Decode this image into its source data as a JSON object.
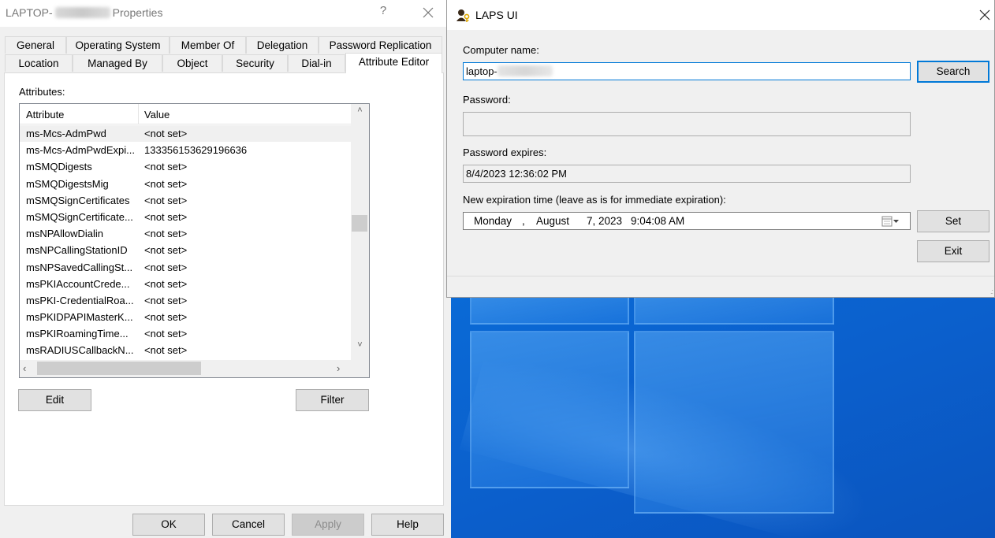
{
  "properties_dialog": {
    "title_prefix": "LAPTOP-",
    "title_suffix": "Properties",
    "help_button": "?",
    "tabs_row1": [
      "General",
      "Operating System",
      "Member Of",
      "Delegation",
      "Password Replication"
    ],
    "tabs_row2": [
      "Location",
      "Managed By",
      "Object",
      "Security",
      "Dial-in",
      "Attribute Editor"
    ],
    "active_tab": "Attribute Editor",
    "attributes_label": "Attributes:",
    "columns": [
      "Attribute",
      "Value"
    ],
    "rows": [
      [
        "ms-Mcs-AdmPwd",
        "<not set>"
      ],
      [
        "ms-Mcs-AdmPwdExpi...",
        "133356153629196636"
      ],
      [
        "mSMQDigests",
        "<not set>"
      ],
      [
        "mSMQDigestsMig",
        "<not set>"
      ],
      [
        "mSMQSignCertificates",
        "<not set>"
      ],
      [
        "mSMQSignCertificate...",
        "<not set>"
      ],
      [
        "msNPAllowDialin",
        "<not set>"
      ],
      [
        "msNPCallingStationID",
        "<not set>"
      ],
      [
        "msNPSavedCallingSt...",
        "<not set>"
      ],
      [
        "msPKIAccountCrede...",
        "<not set>"
      ],
      [
        "msPKI-CredentialRoa...",
        "<not set>"
      ],
      [
        "msPKIDPAPIMasterK...",
        "<not set>"
      ],
      [
        "msPKIRoamingTime...",
        "<not set>"
      ],
      [
        "msRADIUSCallbackN...",
        "<not set>"
      ]
    ],
    "edit_button": "Edit",
    "filter_button": "Filter",
    "ok_button": "OK",
    "cancel_button": "Cancel",
    "apply_button": "Apply",
    "help_text_button": "Help"
  },
  "laps_window": {
    "title": "LAPS UI",
    "computer_name_label": "Computer name:",
    "computer_name_value": "laptop-",
    "search_button": "Search",
    "password_label": "Password:",
    "password_value": "",
    "password_expires_label": "Password expires:",
    "password_expires_value": "8/4/2023 12:36:02 PM",
    "new_expiration_label": "New expiration time (leave as is for immediate expiration):",
    "new_expiration": {
      "weekday": "Monday",
      "sep": ",",
      "month": "August",
      "day_year": "7, 2023",
      "time": "9:04:08 AM"
    },
    "set_button": "Set",
    "exit_button": "Exit"
  }
}
